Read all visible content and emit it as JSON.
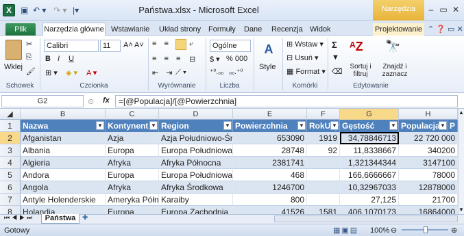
{
  "window": {
    "title": "Państwa.xlsx  -  Microsoft Excel",
    "context_tab": "Narzędzia tabel",
    "app_icon": "X"
  },
  "tabs": [
    "Plik",
    "Narzędzia główne",
    "Wstawianie",
    "Układ strony",
    "Formuły",
    "Dane",
    "Recenzja",
    "Widok",
    "Projektowanie"
  ],
  "ribbon": {
    "paste": "Wklej",
    "clipboard": "Schowek",
    "font_name": "Calibri",
    "font_size": "11",
    "font_group": "Czcionka",
    "align_group": "Wyrównanie",
    "number_format": "Ogólne",
    "percent": "% 000",
    "number_group": "Liczba",
    "style": "Style",
    "insert": "Wstaw",
    "delete": "Usuń",
    "format": "Format",
    "cells_group": "Komórki",
    "sort_filter": "Sortuj i filtruj",
    "find_select": "Znajdź i zaznacz",
    "editing_group": "Edytowanie",
    "bold": "B",
    "italic": "I",
    "underline": "U",
    "grow": "A˄",
    "shrink": "A˅",
    "sigma": "Σ",
    "dec_inc": "⁺⁰.₀₀",
    "dec_dec": "₀₀.⁺⁰"
  },
  "formula_bar": {
    "cell_ref": "G2",
    "fx": "fx",
    "formula": "=[@Populacja]/[@Powierzchnia]"
  },
  "columns": [
    "B",
    "C",
    "D",
    "E",
    "F",
    "G",
    "H"
  ],
  "headers": [
    "Nazwa",
    "Kontynent",
    "Region",
    "Powierzchnia",
    "RokUzys",
    "Gęstość",
    "Populacja",
    "P"
  ],
  "rows": [
    {
      "n": "2",
      "c": [
        "Afganistan",
        "Azja",
        "Azja Południowo-Śr",
        "653090",
        "1919",
        "34,78846713",
        "22 720 000"
      ]
    },
    {
      "n": "3",
      "c": [
        "Albania",
        "Europa",
        "Europa Południowa",
        "28748",
        "92",
        "11,8338667",
        "340200"
      ]
    },
    {
      "n": "4",
      "c": [
        "Algieria",
        "Afryka",
        "Afryka Północna",
        "2381741",
        "",
        "1,321344344",
        "3147100"
      ]
    },
    {
      "n": "5",
      "c": [
        "Andora",
        "Europa",
        "Europa Południowa",
        "468",
        "",
        "166,6666667",
        "78000"
      ]
    },
    {
      "n": "6",
      "c": [
        "Angola",
        "Afryka",
        "Afryka Środkowa",
        "1246700",
        "",
        "10,32967033",
        "12878000"
      ]
    },
    {
      "n": "7",
      "c": [
        "Antyle Holenderskie",
        "Ameryka Półn",
        "Karaiby",
        "800",
        "",
        "27,125",
        "21700"
      ]
    },
    {
      "n": "8",
      "c": [
        "Holandia",
        "Europa",
        "Europa Zachodnia",
        "41526",
        "1581",
        "406,1070173",
        "16864000"
      ]
    }
  ],
  "sheet_tab": "Państwa",
  "status": {
    "ready": "Gotowy",
    "zoom": "100%"
  }
}
